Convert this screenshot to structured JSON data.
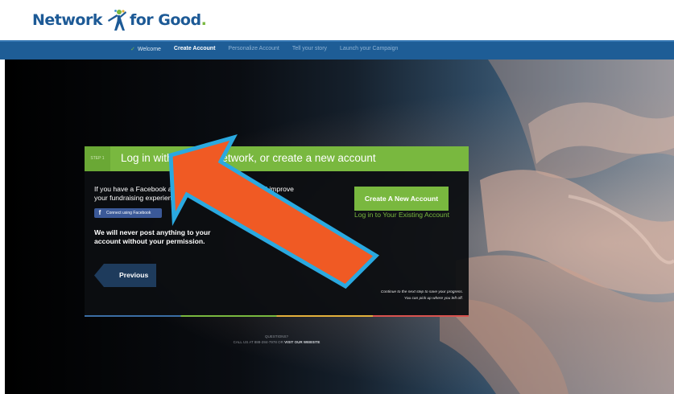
{
  "logo": {
    "text_left": "Network",
    "text_right": "for Good",
    "dot": "."
  },
  "nav": {
    "items": [
      {
        "label": "Welcome",
        "state": "done",
        "check": "✓"
      },
      {
        "label": "Create Account",
        "state": "active"
      },
      {
        "label": "Personalize Account",
        "state": "upcoming"
      },
      {
        "label": "Tell your story",
        "state": "upcoming"
      },
      {
        "label": "Launch your Campaign",
        "state": "upcoming"
      }
    ]
  },
  "panel": {
    "step": "STEP 1",
    "title": "Log in with a social network, or create a new account",
    "facebook_text": "If you have a Facebook account and use it to login, it will improve your fundraising experience.",
    "facebook_button": "Connect using Facebook",
    "facebook_icon": "f",
    "never_post": "We will never post anything to your account without your permission.",
    "create_button": "Create A New Account",
    "login_link": "Log in to Your Existing Account",
    "previous_button": "Previous",
    "save_note_1": "Continue to the next step to save your progress.",
    "save_note_2": "You can pick up where you left off."
  },
  "footer": {
    "questions": "QUESTIONS?",
    "call_prefix": "CALL US AT 888-284-7978 OR",
    "visit_link": "VISIT OUR WEBSITE"
  },
  "colors": {
    "brand_blue": "#1e5d96",
    "brand_green": "#79b83f",
    "facebook_blue": "#3b5998",
    "arrow_orange": "#f05a24",
    "arrow_outline": "#2aa9e0"
  }
}
